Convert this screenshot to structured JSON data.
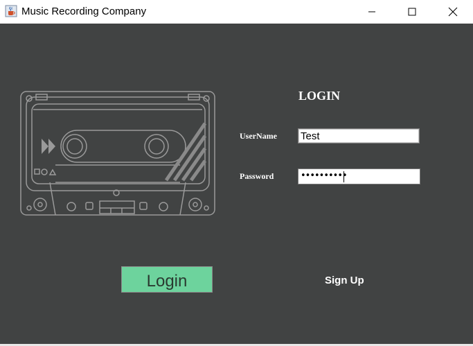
{
  "window": {
    "title": "Music Recording Company",
    "icon": "java-cup-icon"
  },
  "login": {
    "heading": "LOGIN",
    "username_label": "UserName",
    "username_value": "Test",
    "password_label": "Password",
    "password_mask": "••••••••••",
    "login_button": "Login",
    "signup_link": "Sign Up"
  },
  "colors": {
    "background": "#414343",
    "login_button": "#6dd39d",
    "text": "#ffffff"
  },
  "illustration": "cassette-tape-icon"
}
